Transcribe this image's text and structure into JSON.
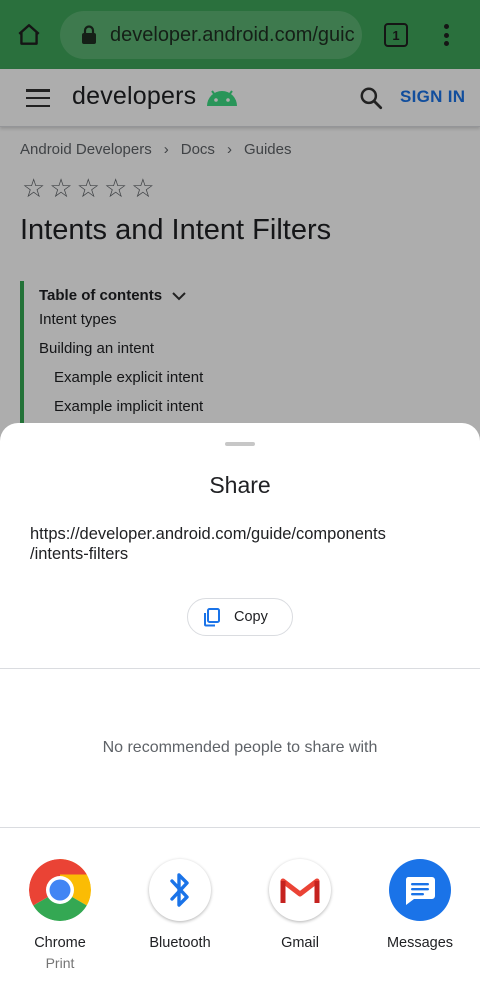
{
  "browser": {
    "url": "developer.android.com/guic",
    "tab_count": "1",
    "bar_color": "#3fa55b"
  },
  "site_header": {
    "brand": "developers",
    "sign_in_label": "SIGN IN"
  },
  "breadcrumb": [
    "Android Developers",
    "Docs",
    "Guides"
  ],
  "rating": {
    "stars_filled": 0,
    "stars_total": 5
  },
  "page_title": "Intents and Intent Filters",
  "toc": {
    "title": "Table of contents",
    "items": [
      "Intent types",
      "Building an intent",
      "Example explicit intent",
      "Example implicit intent"
    ]
  },
  "share_sheet": {
    "title": "Share",
    "url": "https://developer.android.com/guide/components\n/intents-filters",
    "copy_label": "Copy",
    "no_people_text": "No recommended people to share with",
    "apps": [
      {
        "label": "Chrome",
        "sublabel": "Print",
        "icon": "chrome-icon"
      },
      {
        "label": "Bluetooth",
        "sublabel": "",
        "icon": "bluetooth-icon"
      },
      {
        "label": "Gmail",
        "sublabel": "",
        "icon": "gmail-icon"
      },
      {
        "label": "Messages",
        "sublabel": "",
        "icon": "messages-icon"
      }
    ]
  },
  "colors": {
    "accent_blue": "#1a73e8",
    "android_green": "#34a853"
  }
}
